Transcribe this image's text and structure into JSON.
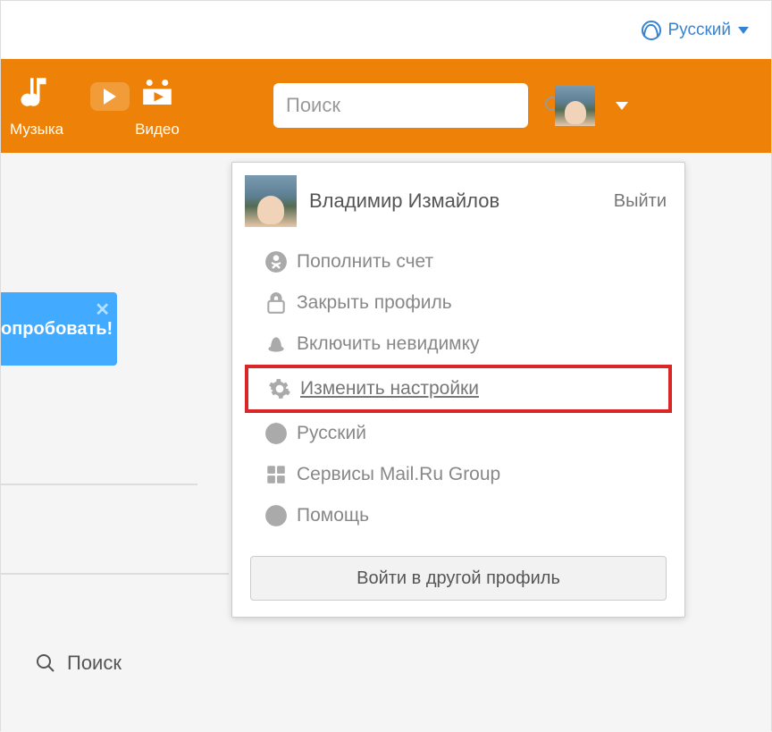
{
  "topbar": {
    "language": "Русский"
  },
  "nav": {
    "music": "Музыка",
    "video": "Видео"
  },
  "search": {
    "placeholder": "Поиск"
  },
  "promo": {
    "text": "опробовать!"
  },
  "bottom_search": {
    "label": "Поиск"
  },
  "dropdown": {
    "username": "Владимир Измайлов",
    "logout": "Выйти",
    "items": [
      {
        "label": "Пополнить счет",
        "icon": "ok-badge"
      },
      {
        "label": "Закрыть профиль",
        "icon": "lock"
      },
      {
        "label": "Включить невидимку",
        "icon": "hat"
      },
      {
        "label": "Изменить настройки",
        "icon": "gear",
        "highlighted": true
      },
      {
        "label": "Русский",
        "icon": "globe"
      },
      {
        "label": "Сервисы Mail.Ru Group",
        "icon": "grid"
      },
      {
        "label": "Помощь",
        "icon": "help"
      }
    ],
    "footer_button": "Войти в другой профиль"
  }
}
